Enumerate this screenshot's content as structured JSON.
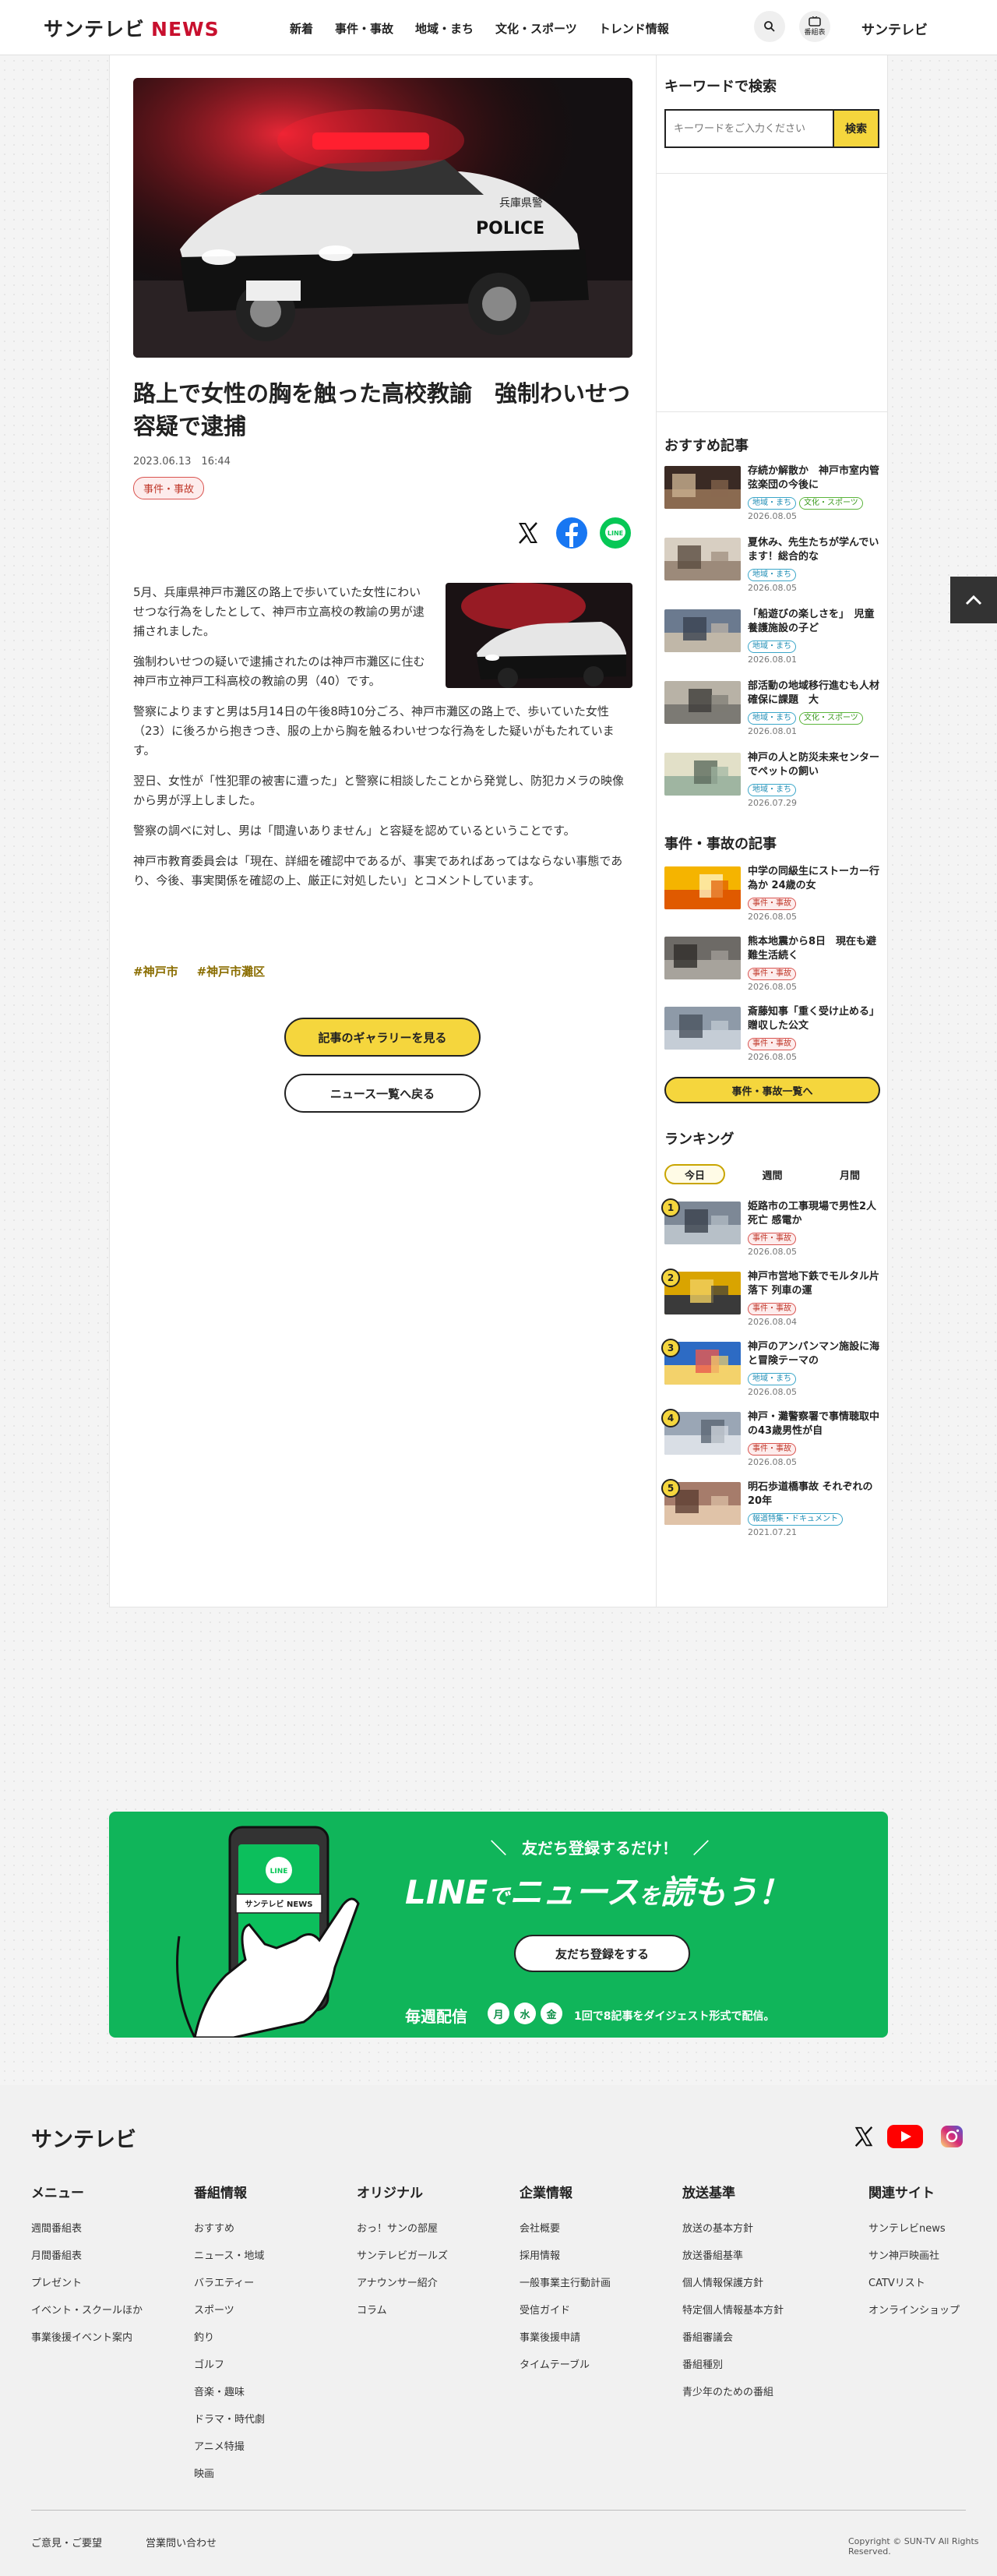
{
  "header": {
    "logo_main": "サンテレビ",
    "logo_news": "NEWS",
    "nav": [
      "新着",
      "事件・事故",
      "地域・まち",
      "文化・スポーツ",
      "トレンド情報"
    ],
    "program_label": "番組表",
    "right_logo": "サンテレビ"
  },
  "article": {
    "title": "路上で女性の胸を触った高校教諭　強制わいせつ容疑で逮捕",
    "date": "2023.06.13　16:44",
    "category": "事件・事故",
    "hero_plate": "POLICE",
    "hero_door_text": "兵庫県警",
    "paragraphs": [
      "5月、兵庫県神戸市灘区の路上で歩いていた女性にわいせつな行為をしたとして、神戸市立高校の教諭の男が逮捕されました。",
      "強制わいせつの疑いで逮捕されたのは神戸市灘区に住む神戸市立神戸工科高校の教諭の男（40）です。",
      "警察によりますと男は5月14日の午後8時10分ごろ、神戸市灘区の路上で、歩いていた女性（23）に後ろから抱きつき、服の上から胸を触るわいせつな行為をした疑いがもたれています。",
      "翌日、女性が「性犯罪の被害に遭った」と警察に相談したことから発覚し、防犯カメラの映像から男が浮上しました。",
      "警察の調べに対し、男は「間違いありません」と容疑を認めているということです。",
      "神戸市教育委員会は「現在、詳細を確認中であるが、事実であればあってはならない事態であり、今後、事実関係を確認の上、厳正に対処したい」とコメントしています。"
    ],
    "tags": [
      "#神戸市",
      "#神戸市灘区"
    ],
    "gallery_button": "記事のギャラリーを見る",
    "back_button": "ニュース一覧へ戻る"
  },
  "sidebar": {
    "search_heading": "キーワードで検索",
    "search_placeholder": "キーワードをご入力ください",
    "search_button": "検索",
    "recommend_heading": "おすすめ記事",
    "recommend": [
      {
        "title": "存続か解散か　神戸市室内管弦楽団の今後に",
        "tags": [
          [
            "area",
            "地域・まち"
          ],
          [
            "culture",
            "文化・スポーツ"
          ]
        ],
        "date": "2026.08.05"
      },
      {
        "title": "夏休み、先生たちが学んでいます！総合的な",
        "tags": [
          [
            "area",
            "地域・まち"
          ]
        ],
        "date": "2026.08.05"
      },
      {
        "title": "「船遊びの楽しさを」　児童養護施設の子ど",
        "tags": [
          [
            "area",
            "地域・まち"
          ]
        ],
        "date": "2026.08.01"
      },
      {
        "title": "部活動の地域移行進むも人材確保に課題　大",
        "tags": [
          [
            "area",
            "地域・まち"
          ],
          [
            "culture",
            "文化・スポーツ"
          ]
        ],
        "date": "2026.08.01"
      },
      {
        "title": "神戸の人と防災未来センターでペットの飼い",
        "tags": [
          [
            "area",
            "地域・まち"
          ]
        ],
        "date": "2026.07.29"
      }
    ],
    "incident_heading": "事件・事故の記事",
    "incidents": [
      {
        "title": "中学の同級生にストーカー行為か 24歳の女",
        "tags": [
          [
            "incident",
            "事件・事故"
          ]
        ],
        "date": "2026.08.05"
      },
      {
        "title": "熊本地震から8日　現在も避難生活続く",
        "tags": [
          [
            "incident",
            "事件・事故"
          ]
        ],
        "date": "2026.08.05"
      },
      {
        "title": "斎藤知事「重く受け止める」 贈収した公文",
        "tags": [
          [
            "incident",
            "事件・事故"
          ]
        ],
        "date": "2026.08.05"
      }
    ],
    "incident_list_button": "事件・事故一覧へ",
    "ranking_heading": "ランキング",
    "ranking_tabs": [
      "今日",
      "週間",
      "月間"
    ],
    "ranking": [
      {
        "num": "1",
        "title": "姫路市の工事現場で男性2人死亡 感電か",
        "tags": [
          [
            "incident",
            "事件・事故"
          ]
        ],
        "date": "2026.08.05"
      },
      {
        "num": "2",
        "title": "神戸市営地下鉄でモルタル片落下 列車の運",
        "tags": [
          [
            "incident",
            "事件・事故"
          ]
        ],
        "date": "2026.08.04"
      },
      {
        "num": "3",
        "title": "神戸のアンパンマン施設に海と冒険テーマの",
        "tags": [
          [
            "area",
            "地域・まち"
          ]
        ],
        "date": "2026.08.05"
      },
      {
        "num": "4",
        "title": "神戸・灘警察署で事情聴取中の43歳男性が自",
        "tags": [
          [
            "incident",
            "事件・事故"
          ]
        ],
        "date": "2026.08.05"
      },
      {
        "num": "5",
        "title": "明石歩道橋事故 それぞれの20年",
        "tags": [
          [
            "special",
            "報道特集・ドキュメント"
          ]
        ],
        "date": "2021.07.21"
      }
    ]
  },
  "line_banner": {
    "phone_brand": "サンテレビ NEWS",
    "sub": "友だち登録するだけ！",
    "main_a": "LINE",
    "main_b": "で",
    "main_c": "ニュース",
    "main_d": "を",
    "main_e": "読もう！",
    "button": "友だち登録をする",
    "weekly": "毎週配信",
    "days": [
      "月",
      "水",
      "金"
    ],
    "desc": "1回で8記事をダイジェスト形式で配信。"
  },
  "footer": {
    "logo": "サンテレビ",
    "columns": [
      {
        "heading": "メニュー",
        "items": [
          "週間番組表",
          "月間番組表",
          "プレゼント",
          "イベント・スクールほか",
          "事業後援イベント案内"
        ]
      },
      {
        "heading": "番組情報",
        "items": [
          "おすすめ",
          "ニュース・地域",
          "バラエティー",
          "スポーツ",
          "釣り",
          "ゴルフ",
          "音楽・趣味",
          "ドラマ・時代劇",
          "アニメ特撮",
          "映画"
        ]
      },
      {
        "heading": "オリジナル",
        "items": [
          "おっ！サンの部屋",
          "サンテレビガールズ",
          "アナウンサー紹介",
          "コラム"
        ]
      },
      {
        "heading": "企業情報",
        "items": [
          "会社概要",
          "採用情報",
          "一般事業主行動計画",
          "受信ガイド",
          "事業後援申請",
          "タイムテーブル"
        ]
      },
      {
        "heading": "放送基準",
        "items": [
          "放送の基本方針",
          "放送番組基準",
          "個人情報保護方針",
          "特定個人情報基本方針",
          "番組審議会",
          "番組種別",
          "青少年のための番組"
        ]
      },
      {
        "heading": "関連サイト",
        "items": [
          "サンテレビnews",
          "サン神戸映画社",
          "CATVリスト",
          "オンラインショップ"
        ]
      }
    ],
    "bottom_links": [
      "ご意見・ご要望",
      "営業問い合わせ"
    ],
    "copyright": "Copyright © SUN-TV All Rights Reserved."
  },
  "colors": {
    "accent_yellow": "#f5d63d",
    "brand_red": "#c8102e",
    "line_green": "#10b55a",
    "incident_red": "#c0392b",
    "area_blue": "#1f8db5",
    "culture_green": "#3c9a1f"
  }
}
